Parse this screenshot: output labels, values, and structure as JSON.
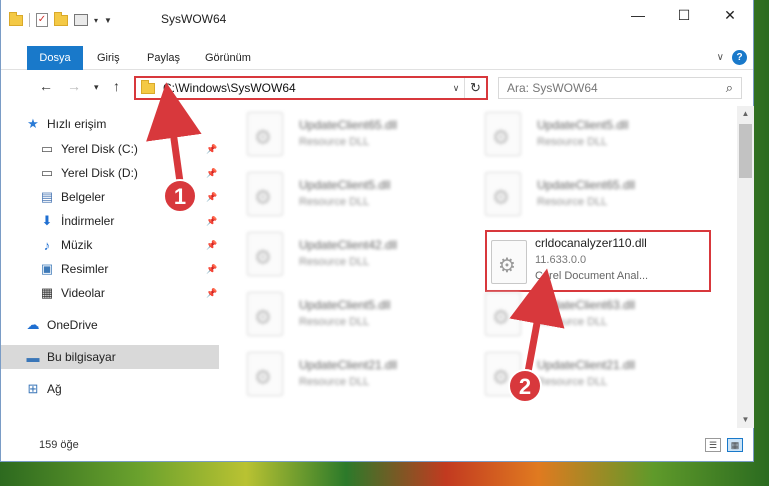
{
  "window": {
    "title": "SysWOW64"
  },
  "ribbon": {
    "tabs": [
      "Dosya",
      "Giriş",
      "Paylaş",
      "Görünüm"
    ]
  },
  "nav": {
    "address": "C:\\Windows\\SysWOW64",
    "search_placeholder": "Ara: SysWOW64"
  },
  "sidebar": {
    "items": [
      {
        "label": "Hızlı erişim",
        "icon": "star-icon"
      },
      {
        "label": "Yerel Disk (C:)",
        "icon": "drive-icon"
      },
      {
        "label": "Yerel Disk (D:)",
        "icon": "drive-icon"
      },
      {
        "label": "Belgeler",
        "icon": "documents-icon"
      },
      {
        "label": "İndirmeler",
        "icon": "download-icon"
      },
      {
        "label": "Müzik",
        "icon": "music-icon"
      },
      {
        "label": "Resimler",
        "icon": "pictures-icon"
      },
      {
        "label": "Videolar",
        "icon": "videos-icon"
      },
      {
        "label": "OneDrive",
        "icon": "cloud-icon"
      },
      {
        "label": "Bu bilgisayar",
        "icon": "computer-icon"
      },
      {
        "label": "Ağ",
        "icon": "network-icon"
      }
    ]
  },
  "files": [
    {
      "name": "UpdateClient65.dll",
      "type": "Resource DLL"
    },
    {
      "name": "UpdateClient5.dll",
      "type": "Resource DLL"
    },
    {
      "name": "UpdateClient5.dll",
      "type": "Resource DLL"
    },
    {
      "name": "UpdateClient65.dll",
      "type": "Resource DLL"
    },
    {
      "name": "UpdateClient42.dll",
      "type": "Resource DLL"
    },
    {
      "name": "crldocanalyzer110.dll",
      "version": "11.633.0.0",
      "description": "Corel Document Anal..."
    },
    {
      "name": "UpdateClient5.dll",
      "type": "Resource DLL"
    },
    {
      "name": "UpdateClient63.dll",
      "type": "Resource DLL"
    },
    {
      "name": "UpdateClient21.dll",
      "type": "Resource DLL"
    },
    {
      "name": "UpdateClient21.dll",
      "type": "Resource DLL"
    }
  ],
  "status": {
    "count": "159 öğe"
  },
  "annotations": {
    "badge1": "1",
    "badge2": "2",
    "color": "#d8383c"
  }
}
